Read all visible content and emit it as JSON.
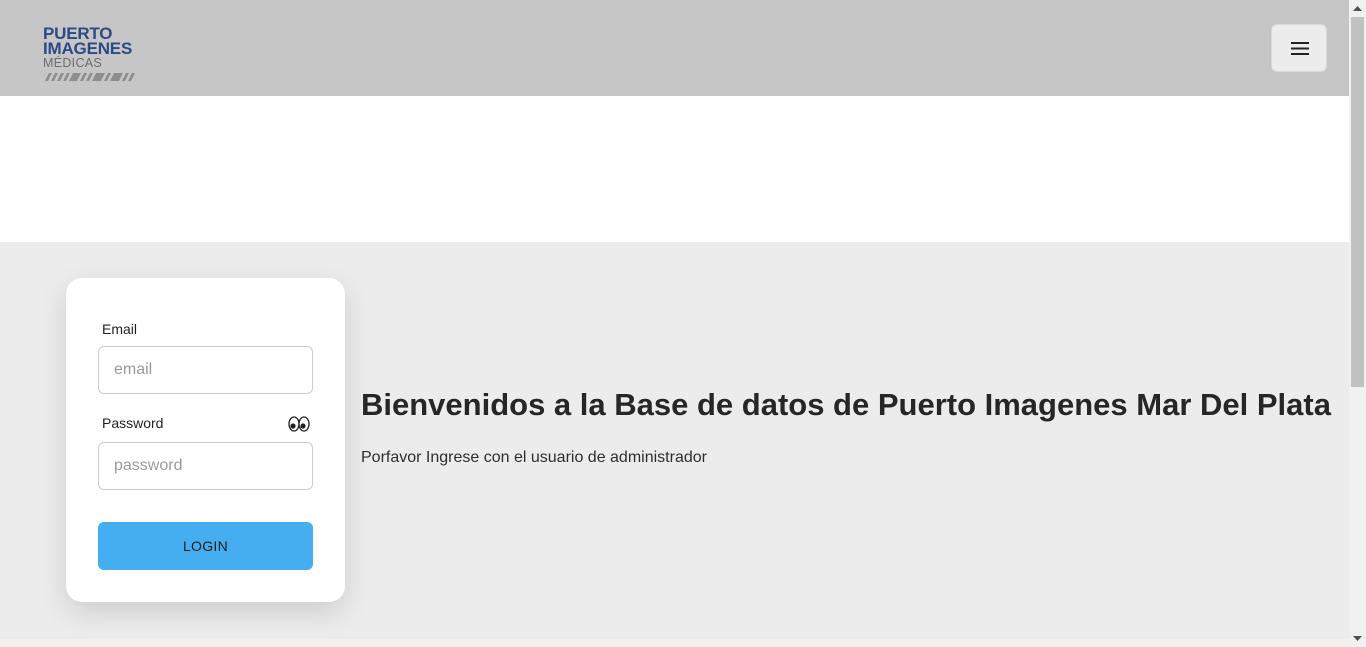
{
  "header": {
    "logo": {
      "line1": "PUERTO",
      "line2": "IMAGENES",
      "line3": "MÉDICAS"
    },
    "menu_icon": "hamburger-menu-icon",
    "background": "#c6c6c6"
  },
  "login": {
    "email_label": "Email",
    "email_placeholder": "email",
    "email_value": "",
    "password_label": "Password",
    "password_placeholder": "password",
    "password_value": "",
    "password_toggle_icon": "eyes-icon",
    "button_label": "LOGIN",
    "button_color": "#45aef0"
  },
  "main": {
    "title": "Bienvenidos a la Base de datos de Puerto Imagenes Mar Del Plata",
    "subtitle": "Porfavor Ingrese con el usuario de administrador"
  },
  "colors": {
    "brand": "#2b4a86",
    "section_background": "#ececec"
  }
}
